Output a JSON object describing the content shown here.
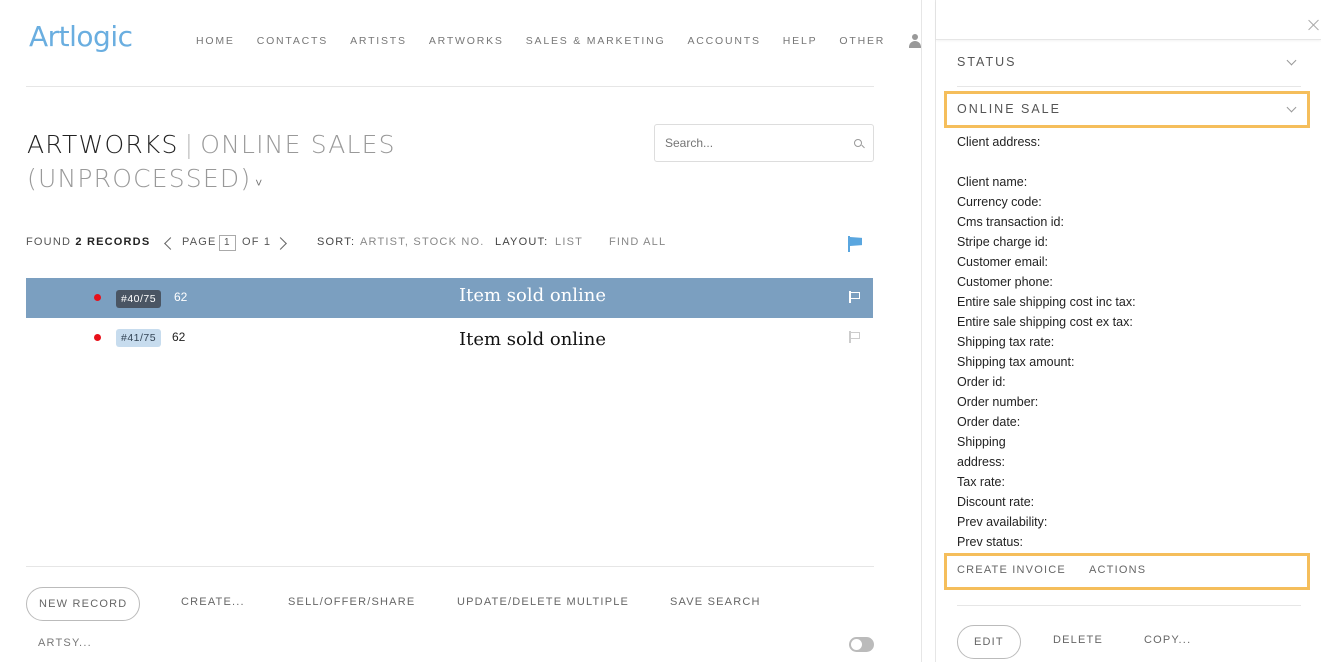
{
  "brand": {
    "logo_text": "Artlogic",
    "logo_color": "#6aaee0"
  },
  "nav": {
    "items": [
      "HOME",
      "CONTACTS",
      "ARTISTS",
      "ARTWORKS",
      "SALES & MARKETING",
      "ACCOUNTS",
      "HELP",
      "OTHER"
    ],
    "user_icon": "user-icon"
  },
  "page": {
    "title_main": "ARTWORKS",
    "title_separator": "|",
    "title_sub": "ONLINE SALES (UNPROCESSED)",
    "title_caret": "˅"
  },
  "search": {
    "placeholder": "Search..."
  },
  "toolbar": {
    "found_prefix": "FOUND",
    "found_count": "2 RECORDS",
    "page_label": "PAGE",
    "page_current": "1",
    "page_of": "OF 1",
    "sort_label": "SORT:",
    "sort_value": "ARTIST, STOCK NO.",
    "layout_label": "LAYOUT:",
    "layout_value": "LIST",
    "find_all": "FIND ALL"
  },
  "records": [
    {
      "badge": "#40/75",
      "number": "62",
      "title": "Item sold online",
      "selected": true
    },
    {
      "badge": "#41/75",
      "number": "62",
      "title": "Item sold online",
      "selected": false
    }
  ],
  "bottom": {
    "new_record": "NEW RECORD",
    "create": "CREATE...",
    "sell": "SELL/OFFER/SHARE",
    "update": "UPDATE/DELETE MULTIPLE",
    "save_search": "SAVE SEARCH",
    "artsy": "ARTSY..."
  },
  "panel": {
    "status_label": "STATUS",
    "online_sale_label": "ONLINE SALE",
    "fields": [
      "Client address:",
      "Client name:",
      "Currency code:",
      "Cms transaction id:",
      "Stripe charge id:",
      "Customer email:",
      "Customer phone:",
      "Entire sale shipping cost inc tax:",
      "Entire sale shipping cost ex tax:",
      "Shipping tax rate:",
      "Shipping tax amount:",
      "Order id:",
      "Order number:",
      "Order date:",
      "Shipping",
      "address:",
      "Tax rate:",
      "Discount rate:",
      "Prev availability:",
      "Prev status:"
    ],
    "create_invoice": "CREATE INVOICE",
    "actions": "ACTIONS",
    "edit": "EDIT",
    "delete": "DELETE",
    "copy": "COPY..."
  },
  "colors": {
    "selected_row": "#7b9fc0",
    "highlight": "#f5be5b",
    "status_dot": "#e8101a",
    "flag_blue": "#5aa6df"
  }
}
